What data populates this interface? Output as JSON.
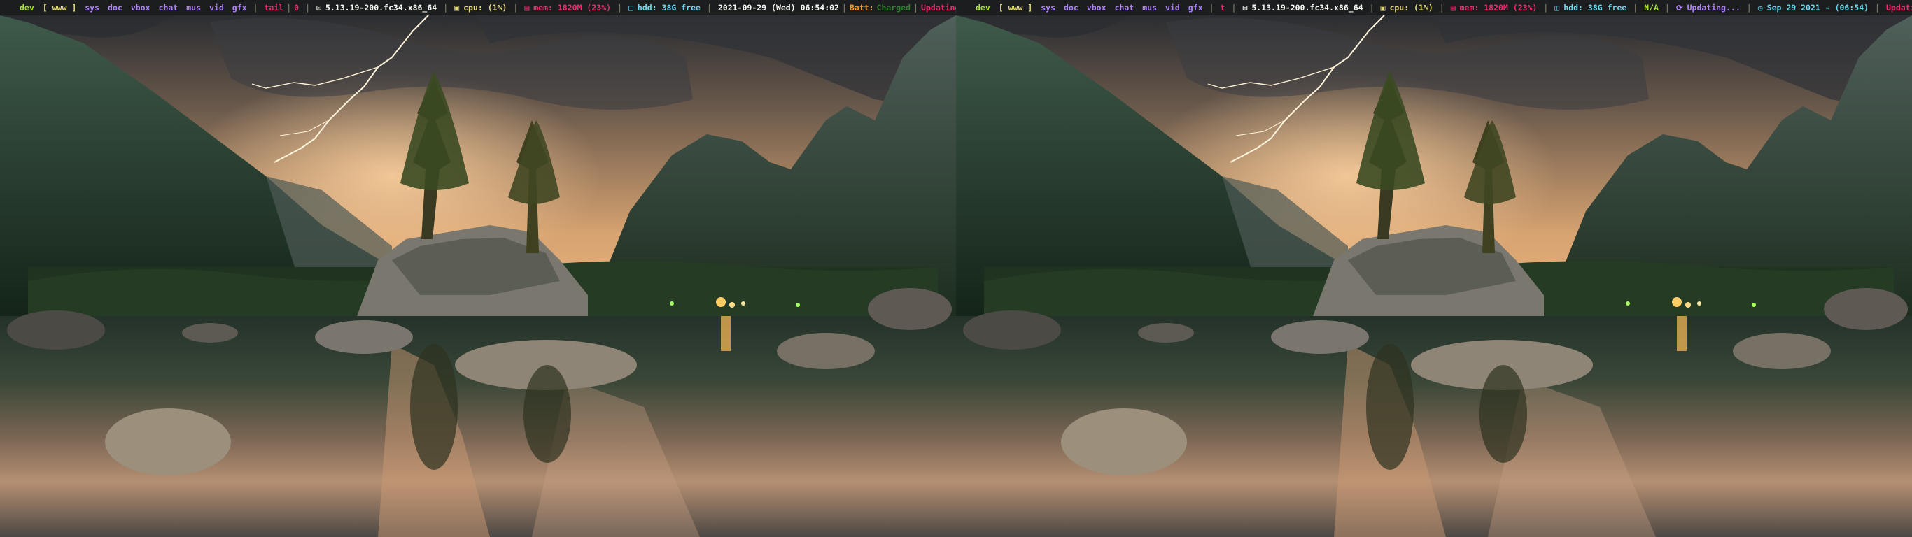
{
  "left_bar": {
    "workspaces": [
      {
        "label": "dev",
        "style": "ws-dev"
      },
      {
        "label": "[ www ]",
        "style": "ws-www"
      },
      {
        "label": "sys",
        "style": "ws-other"
      },
      {
        "label": "doc",
        "style": "ws-other"
      },
      {
        "label": "vbox",
        "style": "ws-other"
      },
      {
        "label": "chat",
        "style": "ws-other"
      },
      {
        "label": "mus",
        "style": "ws-other"
      },
      {
        "label": "vid",
        "style": "ws-other"
      },
      {
        "label": "gfx",
        "style": "ws-other"
      }
    ],
    "window_title": "tail",
    "counter": "0",
    "kernel": "5.13.19-200.fc34.x86_64",
    "cpu": "cpu: (1%)",
    "mem": "mem: 1820M (23%)",
    "hdd": "hdd: 38G free",
    "date": "2021-09-29 (Wed) 06:54:02",
    "batt_label": "Batt:",
    "batt_value": "Charged",
    "updating": "Updating..."
  },
  "right_bar": {
    "workspaces": [
      {
        "label": "dev",
        "style": "ws-dev"
      },
      {
        "label": "[ www ]",
        "style": "ws-www"
      },
      {
        "label": "sys",
        "style": "ws-other"
      },
      {
        "label": "doc",
        "style": "ws-other"
      },
      {
        "label": "vbox",
        "style": "ws-other"
      },
      {
        "label": "chat",
        "style": "ws-other"
      },
      {
        "label": "mus",
        "style": "ws-other"
      },
      {
        "label": "vid",
        "style": "ws-other"
      },
      {
        "label": "gfx",
        "style": "ws-other"
      }
    ],
    "window_title": "t",
    "kernel": "5.13.19-200.fc34.x86_64",
    "cpu": "cpu: (1%)",
    "mem": "mem: 1820M (23%)",
    "hdd": "hdd: 38G free",
    "battery": "N/A",
    "updating_mid": "Updating...",
    "clock": "Sep 29 2021 - (06:54)",
    "updating": "Updating..."
  },
  "icons": {
    "kernel": "linux-icon",
    "cpu": "cpu-icon",
    "mem": "memory-icon",
    "hdd": "hdd-icon",
    "updates": "update-icon",
    "clock": "clock-icon"
  },
  "colors": {
    "bar_bg": "#1b1d1e",
    "green": "#a6e22e",
    "yellow": "#e6db74",
    "purple": "#ae81ff",
    "pink": "#f92672",
    "cyan": "#66d9ef",
    "orange": "#fd971f"
  }
}
